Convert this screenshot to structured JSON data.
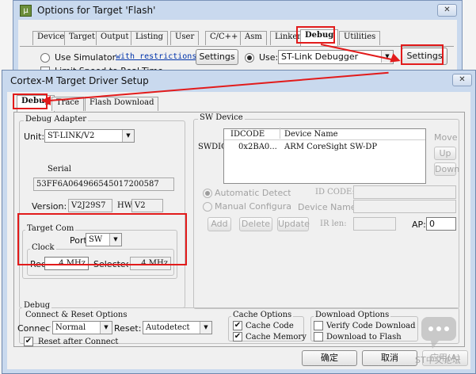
{
  "back_window": {
    "title": "Options for Target 'Flash'",
    "app_icon": "µ",
    "tabs": [
      "Device",
      "Target",
      "Output",
      "Listing",
      "User",
      "C/C++",
      "Asm",
      "Linker",
      "Debug",
      "Utilities"
    ],
    "use_simulator": "Use Simulator",
    "with_restrictions": "with restrictions",
    "settings_left": "Settings",
    "use_label": "Use:",
    "debugger": "ST-Link Debugger",
    "settings_right": "Settings",
    "limit_speed": "Limit Speed to Real-Time"
  },
  "dialog": {
    "title": "Cortex-M Target Driver Setup",
    "tabs": [
      "Debug",
      "Trace",
      "Flash Download"
    ],
    "debug_adapter": {
      "group": "Debug Adapter",
      "unit_label": "Unit:",
      "unit_value": "ST-LINK/V2",
      "serial_label": "Serial",
      "serial_value": "53FF6A064966545017200587",
      "version_label": "Version:",
      "version_value": "V2J29S7",
      "hw_label": "HW:",
      "hw_value": "V2"
    },
    "target_com": {
      "group": "Target Com",
      "port_label": "Port:",
      "port_value": "SW",
      "clock_group": "Clock",
      "req_label": "Req:",
      "req_value": "4 MHz",
      "selected_label": "Selected:",
      "selected_value": "4 MHz"
    },
    "sw_device": {
      "group": "SW Device",
      "swdio": "SWDIO",
      "col_idcode": "IDCODE",
      "col_device": "Device Name",
      "row_idcode": "0x2BA0...",
      "row_device": "ARM CoreSight SW-DP",
      "move": "Move",
      "up": "Up",
      "down": "Down",
      "auto_detect": "Automatic Detection",
      "manual_config": "Manual Configuration",
      "id_code_label": "ID CODE:",
      "device_name_label": "Device Name:",
      "add": "Add",
      "delete": "Delete",
      "update": "Update",
      "ir_len_label": "IR len:",
      "ap_label": "AP:",
      "ap_value": "0"
    },
    "debug_group": {
      "group": "Debug",
      "connect_reset": "Connect & Reset Options",
      "connect_label": "Connect:",
      "connect_value": "Normal",
      "reset_label": "Reset:",
      "reset_value": "Autodetect",
      "reset_after_connect": "Reset after Connect",
      "cache_options": "Cache Options",
      "cache_code": "Cache Code",
      "cache_memory": "Cache Memory",
      "download_options": "Download Options",
      "verify_code": "Verify Code Download",
      "download_flash": "Download to Flash"
    },
    "ok": "确定",
    "cancel": "取消",
    "apply": "应用(A)"
  },
  "watermark_text": "ST中文论坛",
  "colors": {
    "annotation_red": "#e21b1b",
    "title_bar": "#c9d9ee",
    "link_blue": "#0033aa"
  }
}
